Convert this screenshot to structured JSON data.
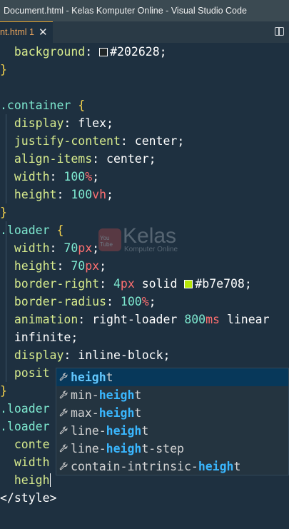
{
  "window": {
    "title": "Document.html - Kelas Komputer Online - Visual Studio Code"
  },
  "tab": {
    "label": "nt.html 1",
    "close": "✕"
  },
  "colors": {
    "swatch_bg": "#202628",
    "swatch_green": "#b7e708"
  },
  "code": {
    "l1_prop": "background",
    "l1_val": "#202628",
    "l2": "}",
    "l4_sel": ".container",
    "l4_brace": "{",
    "l5_prop": "display",
    "l5_val": "flex",
    "l6_prop": "justify-content",
    "l6_val": "center",
    "l7_prop": "align-items",
    "l7_val": "center",
    "l8_prop": "width",
    "l8_num": "100",
    "l8_unit": "%",
    "l9_prop": "height",
    "l9_num": "100",
    "l9_unit": "vh",
    "l10": "}",
    "l11_sel": ".loader",
    "l11_brace": "{",
    "l12_prop": "width",
    "l12_num": "70",
    "l12_unit": "px",
    "l13_prop": "height",
    "l13_num": "70",
    "l13_unit": "px",
    "l14_prop": "border-right",
    "l14_num": "4",
    "l14_unit": "px",
    "l14_val": "solid",
    "l14_color": "#b7e708",
    "l15_prop": "border-radius",
    "l15_num": "100",
    "l15_unit": "%",
    "l16_prop": "animation",
    "l16_val1": "right-loader",
    "l16_num": "800",
    "l16_unit": "ms",
    "l16_val2": "linear",
    "l17_val": "infinite",
    "l18_prop": "display",
    "l18_val": "inline-block",
    "l19_prop": "posit",
    "l20": "}",
    "l21_sel": ".loader",
    "l22_sel": ".loader",
    "l23_prop": "conte",
    "l24_prop": "width",
    "l25_typed": "heigh",
    "l26_tag": "</style>"
  },
  "watermark": {
    "title": "Kelas",
    "sub": "Komputer Online"
  },
  "suggestions": [
    {
      "pre": "",
      "match": "heigh",
      "post": "t"
    },
    {
      "pre": "min-",
      "match": "heigh",
      "post": "t"
    },
    {
      "pre": "max-",
      "match": "heigh",
      "post": "t"
    },
    {
      "pre": "line-",
      "match": "heigh",
      "post": "t"
    },
    {
      "pre": "line-",
      "match": "heigh",
      "post": "t-step"
    },
    {
      "pre": "contain-intrinsic-",
      "match": "heigh",
      "post": "t"
    }
  ],
  "suggestion_icon": "wrench-icon"
}
